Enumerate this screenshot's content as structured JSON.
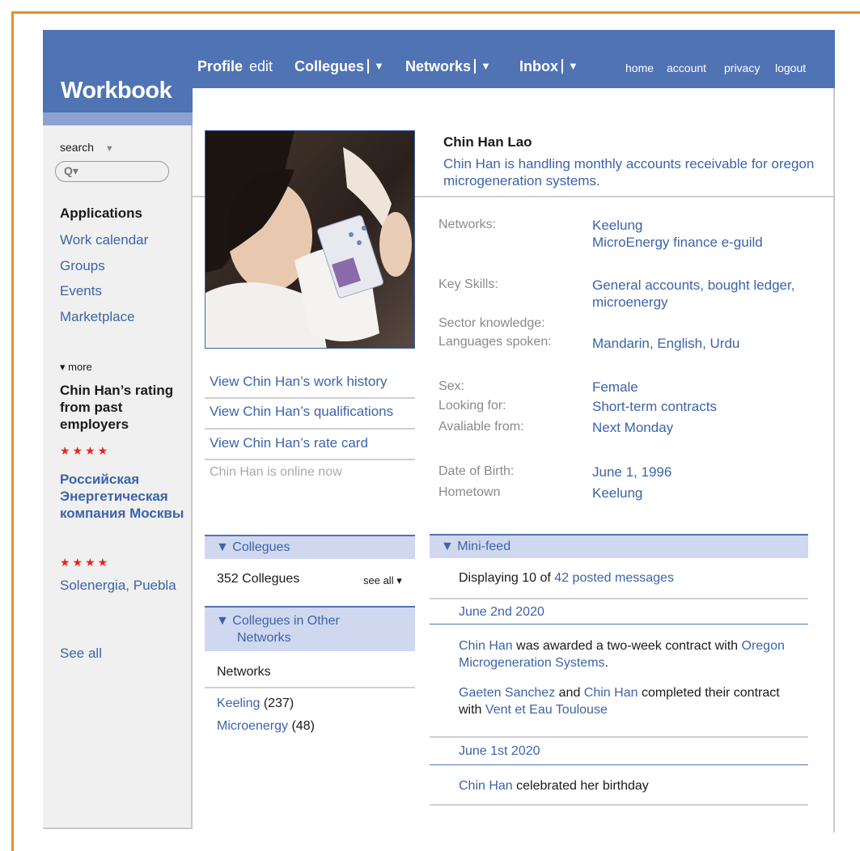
{
  "brand": "Workbook",
  "nav": {
    "profile": "Profile",
    "edit": "edit",
    "colleagues": "Collegues",
    "networks": "Networks",
    "inbox": "Inbox",
    "dropdown_arrow": "▼"
  },
  "utility": [
    "home",
    "account",
    "privacy",
    "logout"
  ],
  "sidebar": {
    "search_label": "search",
    "search_arrow": "▼",
    "search_icon_text": "Q▾",
    "apps_heading": "Applications",
    "apps": [
      "Work calendar",
      "Groups",
      "Events",
      "Marketplace"
    ],
    "more": "▾ more",
    "rating_heading": "Chin Han’s rating from past employers",
    "stars": "★★★★",
    "org1": "Российская Энергетическая компания Москвы",
    "org2": "Solenergia, Puebla",
    "see_all": "See all"
  },
  "profile": {
    "name": "Chin Han Lao",
    "status": "Chin Han is handling monthly accounts receivable for oregon microgeneration systems.",
    "links": [
      "View Chin Han’s work history",
      "View Chin Han’s qualifications",
      "View Chin Han’s rate card"
    ],
    "online": "Chin Han is online now"
  },
  "info": {
    "networks_label": "Networks:",
    "networks_1": "Keelung",
    "networks_2": "MicroEnergy finance e-guild",
    "skills_label": "Key Skills:",
    "skills_value": "General accounts, bought ledger, microenergy",
    "sector_label": "Sector knowledge:",
    "languages_label": "Languages spoken:",
    "languages_value": "Mandarin, English, Urdu",
    "sex_label": "Sex:",
    "sex_value": "Female",
    "looking_label": "Looking for:",
    "looking_value": "Short-term contracts",
    "available_label": "Avaliable from:",
    "available_value": "Next Monday",
    "dob_label": "Date of Birth:",
    "dob_value": "June 1, 1996",
    "hometown_label": "Hometown",
    "hometown_value": "Keelung"
  },
  "colleagues": {
    "heading": "▼  Collegues",
    "count": "352 Collegues",
    "see_all": "see all ▾",
    "other_heading_1": "▼  Collegues in Other",
    "other_heading_2": "Networks",
    "networks_title": "Networks",
    "net1_name": "Keeling",
    "net1_count": " (237)",
    "net2_name": "Microenergy",
    "net2_count": " (48)"
  },
  "feed": {
    "heading": "▼  Mini-feed",
    "display_prefix": "Displaying 10 of ",
    "display_link": "42 posted messages",
    "date1": "June 2nd 2020",
    "e1_a": "Chin Han",
    "e1_b": " was awarded a two-week contract with ",
    "e1_c": "Oregon Microgeneration Systems",
    "e1_d": ".",
    "e2_a": "Gaeten Sanchez",
    "e2_b": " and ",
    "e2_c": "Chin Han",
    "e2_d": " completed their contract with ",
    "e2_e": "Vent et Eau Toulouse",
    "date2": "June 1st 2020",
    "e3_a": "Chin Han",
    "e3_b": " celebrated her birthday"
  }
}
